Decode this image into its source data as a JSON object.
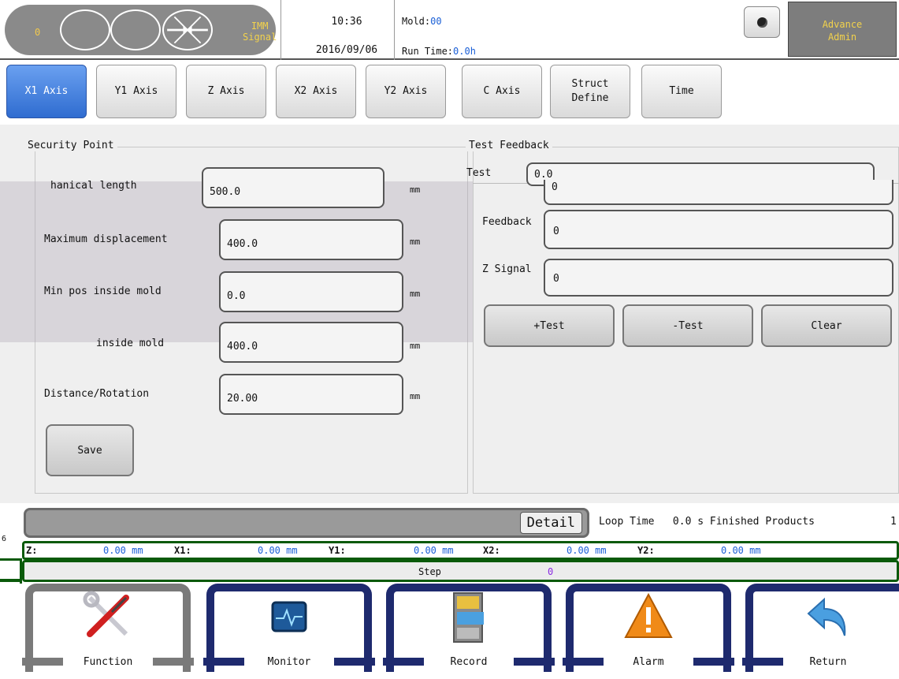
{
  "header": {
    "status_count": "0",
    "imm_signal_line1": "IMM",
    "imm_signal_line2": "Signal",
    "time": "10:36",
    "date": "2016/09/06",
    "mold_label": "Mold:",
    "mold_value": "00",
    "runtime_label": "Run Time:",
    "runtime_value": "0.0h",
    "user_line1": "Advance",
    "user_line2": "Admin",
    "icons": [
      "status-circle-icon",
      "status-circle-icon",
      "arrows-inward-icon",
      "camera-icon"
    ]
  },
  "tabs": [
    {
      "label": "X1 Axis",
      "active": true
    },
    {
      "label": "Y1 Axis"
    },
    {
      "label": "Z Axis"
    },
    {
      "label": "X2 Axis"
    },
    {
      "label": "Y2 Axis"
    },
    {
      "label": "C Axis"
    },
    {
      "label": "Struct\nDefine"
    },
    {
      "label": "Time"
    }
  ],
  "security": {
    "title": "Security Point",
    "rows": [
      {
        "label": "Mechanical length",
        "display_label": "hanical length",
        "value": "500.0",
        "unit": "mm"
      },
      {
        "label": "Maximum displacement",
        "value": "400.0",
        "unit": "mm"
      },
      {
        "label": "Min pos inside mold",
        "value": "0.0",
        "unit": "mm"
      },
      {
        "label": "Max pos inside mold",
        "display_label": "inside mold",
        "value": "400.0",
        "unit": "mm"
      },
      {
        "label": "Distance/Rotation",
        "value": "20.00",
        "unit": "mm"
      }
    ],
    "save_label": "Save"
  },
  "feedback": {
    "title": "Test Feedback",
    "test_label": "Test",
    "test_value": "0.0",
    "test_value_lower": "0",
    "feedback_label": "Feedback",
    "feedback_value": "0",
    "zsignal_label": "Z Signal",
    "zsignal_value": "0",
    "plus_test": "+Test",
    "minus_test": "-Test",
    "clear": "Clear"
  },
  "status": {
    "detail": "Detail",
    "loop_time": "Loop Time   0.0 s Finished Products",
    "right_number": "1",
    "left_number": "6"
  },
  "axes": [
    {
      "name": "Z:",
      "value": "0.00",
      "unit": "mm"
    },
    {
      "name": "X1:",
      "value": "0.00",
      "unit": "mm"
    },
    {
      "name": "Y1:",
      "value": "0.00",
      "unit": "mm"
    },
    {
      "name": "X2:",
      "value": "0.00",
      "unit": "mm"
    },
    {
      "name": "Y2:",
      "value": "0.00",
      "unit": "mm"
    }
  ],
  "step": {
    "label": "Step",
    "value": "0"
  },
  "nav": [
    {
      "label": "Function",
      "icon": "tools-icon"
    },
    {
      "label": "Monitor",
      "icon": "monitor-icon"
    },
    {
      "label": "Record",
      "icon": "file-cabinet-icon"
    },
    {
      "label": "Alarm",
      "icon": "warning-icon"
    },
    {
      "label": "Return",
      "icon": "return-arrow-icon"
    }
  ]
}
